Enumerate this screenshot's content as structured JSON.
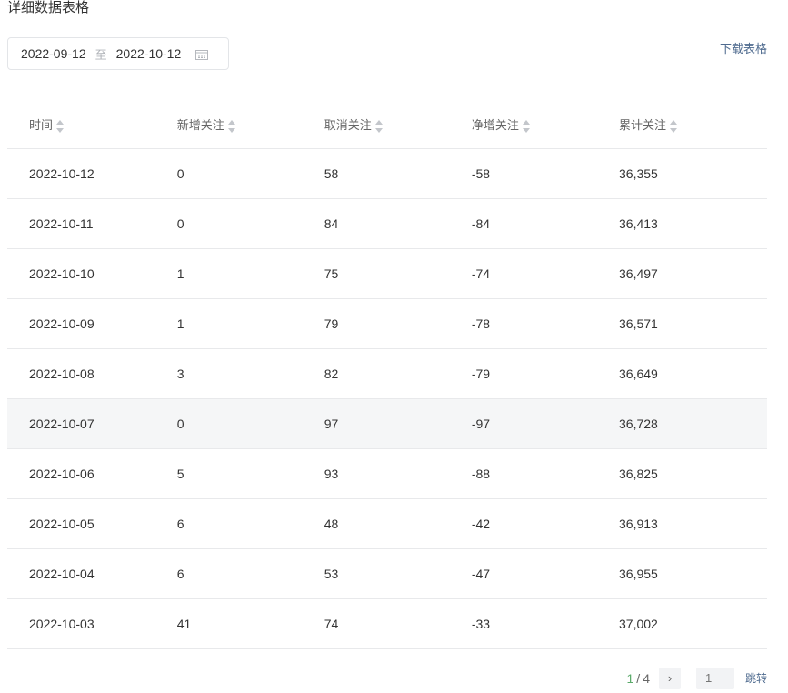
{
  "title": "详细数据表格",
  "date_range": {
    "start": "2022-09-12",
    "separator": "至",
    "end": "2022-10-12",
    "icon": "calendar-icon"
  },
  "download_label": "下载表格",
  "table": {
    "headers": [
      "时间",
      "新增关注",
      "取消关注",
      "净增关注",
      "累计关注"
    ],
    "rows": [
      [
        "2022-10-12",
        "0",
        "58",
        "-58",
        "36,355"
      ],
      [
        "2022-10-11",
        "0",
        "84",
        "-84",
        "36,413"
      ],
      [
        "2022-10-10",
        "1",
        "75",
        "-74",
        "36,497"
      ],
      [
        "2022-10-09",
        "1",
        "79",
        "-78",
        "36,571"
      ],
      [
        "2022-10-08",
        "3",
        "82",
        "-79",
        "36,649"
      ],
      [
        "2022-10-07",
        "0",
        "97",
        "-97",
        "36,728"
      ],
      [
        "2022-10-06",
        "5",
        "93",
        "-88",
        "36,825"
      ],
      [
        "2022-10-05",
        "6",
        "48",
        "-42",
        "36,913"
      ],
      [
        "2022-10-04",
        "6",
        "53",
        "-47",
        "36,955"
      ],
      [
        "2022-10-03",
        "41",
        "74",
        "-33",
        "37,002"
      ]
    ],
    "highlighted_row": 5
  },
  "pagination": {
    "current": "1",
    "separator": "/",
    "total": "4",
    "next_icon": "chevron-right-icon",
    "jump_input_placeholder": "1",
    "jump_label": "跳转"
  },
  "colors": {
    "accent_green": "#5aaa6a",
    "link_blue": "#4f6b8f"
  }
}
